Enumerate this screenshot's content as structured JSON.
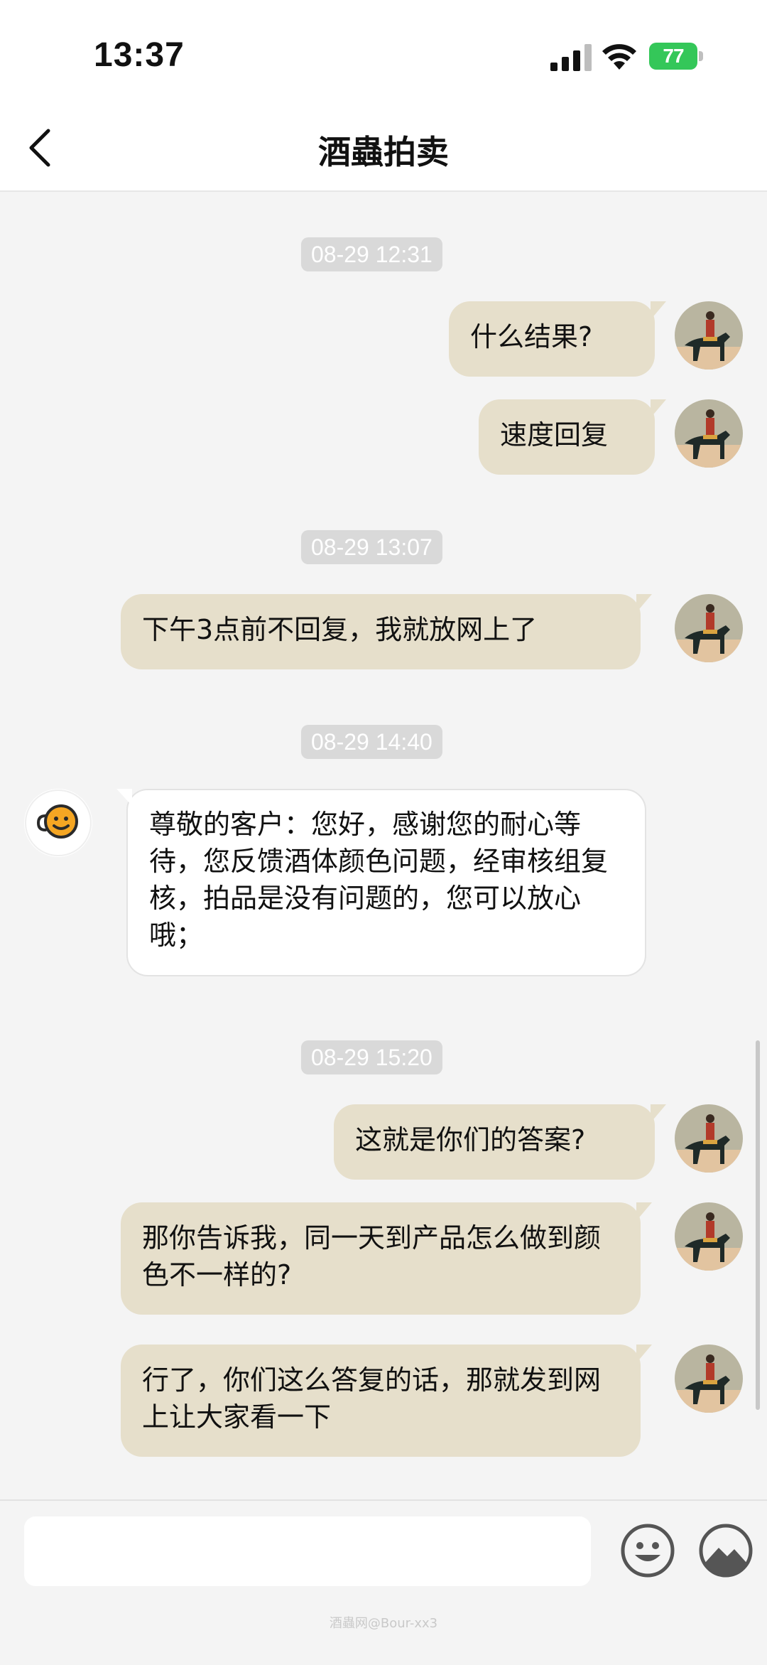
{
  "status_bar": {
    "time": "13:37",
    "battery": "77"
  },
  "header": {
    "title": "酒蟲拍卖"
  },
  "timestamps": [
    "08-29 12:31",
    "08-29 13:07",
    "08-29 14:40",
    "08-29 15:20"
  ],
  "messages": [
    {
      "sender": "me",
      "text": "什么结果?"
    },
    {
      "sender": "me",
      "text": "速度回复"
    },
    {
      "sender": "me",
      "text": "下午3点前不回复，我就放网上了"
    },
    {
      "sender": "bot",
      "text": "尊敬的客户：您好，感谢您的耐心等待，您反馈酒体颜色问题，经审核组复核，拍品是没有问题的，您可以放心哦；"
    },
    {
      "sender": "me",
      "text": "这就是你们的答案?"
    },
    {
      "sender": "me",
      "text": "那你告诉我，同一天到产品怎么做到颜色不一样的?"
    },
    {
      "sender": "me",
      "text": "行了，你们这么答复的话，那就发到网上让大家看一下"
    }
  ],
  "composer": {
    "input_value": "",
    "watermark": "酒蟲网@Bour-xx3"
  },
  "icons": {
    "back": "chevron-left-icon",
    "emoji": "smiley-icon",
    "image": "image-icon",
    "bot_avatar": "chat-smiley-icon",
    "user_avatar": "horse-rider-avatar"
  },
  "colors": {
    "my_bubble": "#e6dfcb",
    "bot_bubble": "#ffffff",
    "timestamp_bg": "#d9d9d9",
    "battery": "#34c759",
    "background": "#f4f4f4"
  }
}
